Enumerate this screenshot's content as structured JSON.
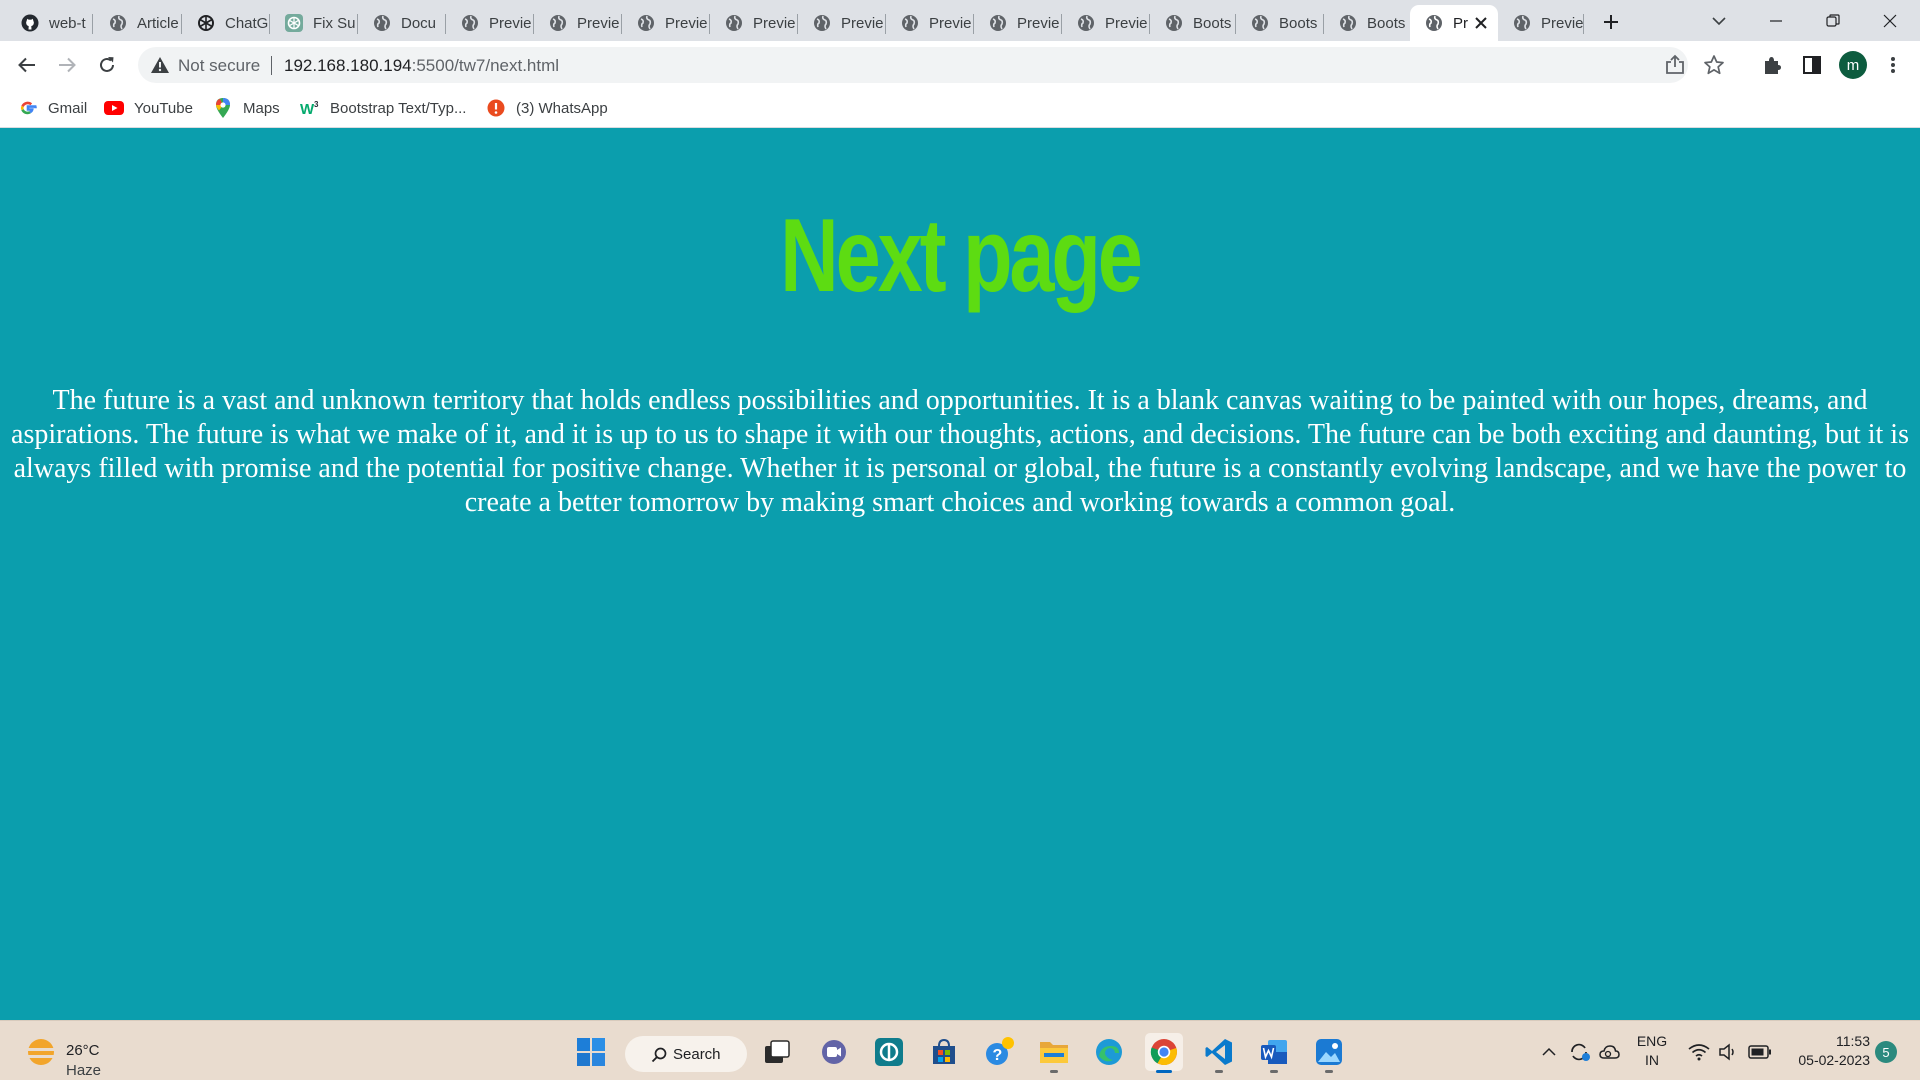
{
  "browser": {
    "tabs": [
      {
        "label": "web-t",
        "icon": "github-icon"
      },
      {
        "label": "Article",
        "icon": "globe-icon"
      },
      {
        "label": "ChatGPT",
        "icon": "openai-icon"
      },
      {
        "label": "Fix Su",
        "icon": "openai-icon"
      },
      {
        "label": "Docu",
        "icon": "globe-icon"
      },
      {
        "label": "Previe",
        "icon": "globe-icon"
      },
      {
        "label": "Previe",
        "icon": "globe-icon"
      },
      {
        "label": "Previe",
        "icon": "globe-icon"
      },
      {
        "label": "Previe",
        "icon": "globe-icon"
      },
      {
        "label": "Previe",
        "icon": "globe-icon"
      },
      {
        "label": "Previe",
        "icon": "globe-icon"
      },
      {
        "label": "Previe",
        "icon": "globe-icon"
      },
      {
        "label": "Previe",
        "icon": "globe-icon"
      },
      {
        "label": "Boots",
        "icon": "globe-icon"
      },
      {
        "label": "Boots",
        "icon": "globe-icon"
      },
      {
        "label": "Boots",
        "icon": "globe-icon"
      },
      {
        "label": "Pr",
        "icon": "globe-icon",
        "active": true
      },
      {
        "label": "Previe",
        "icon": "globe-icon"
      }
    ],
    "address": {
      "security_label": "Not secure",
      "host": "192.168.180.194",
      "path": ":5500/tw7/next.html"
    },
    "profile_initial": "m",
    "bookmarks": [
      {
        "label": "Gmail",
        "icon": "google-icon"
      },
      {
        "label": "YouTube",
        "icon": "youtube-icon"
      },
      {
        "label": "Maps",
        "icon": "maps-pin-icon"
      },
      {
        "label": "Bootstrap Text/Typ...",
        "icon": "w3schools-icon"
      },
      {
        "label": "(3) WhatsApp",
        "icon": "alert-icon"
      }
    ]
  },
  "page": {
    "heading": "Next page",
    "paragraph": "The future is a vast and unknown territory that holds endless possibilities and opportunities. It is a blank canvas waiting to be painted with our hopes, dreams, and aspirations. The future is what we make of it, and it is up to us to shape it with our thoughts, actions, and decisions. The future can be both exciting and daunting, but it is always filled with promise and the potential for positive change. Whether it is personal or global, the future is a constantly evolving landscape, and we have the power to create a better tomorrow by making smart choices and working towards a common goal.",
    "colors": {
      "background": "#0b9ead",
      "heading": "#5ddc12",
      "text": "#ffffff"
    }
  },
  "taskbar": {
    "weather": {
      "temp": "26°C",
      "desc": "Haze"
    },
    "search_label": "Search",
    "language": {
      "line1": "ENG",
      "line2": "IN"
    },
    "clock": {
      "time": "11:53",
      "date": "05-02-2023"
    },
    "notifications": "5"
  }
}
